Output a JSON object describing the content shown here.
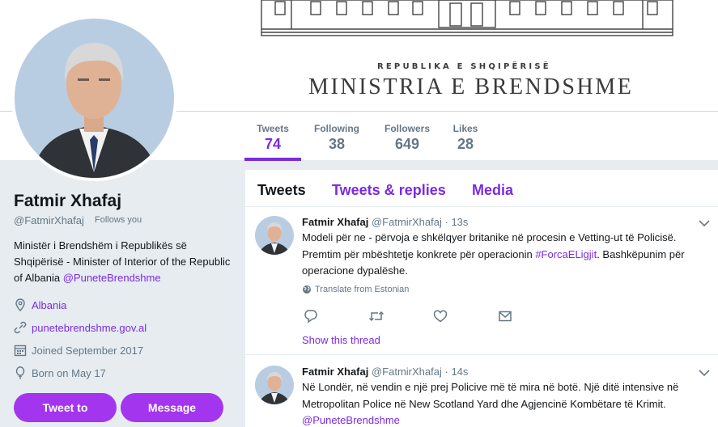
{
  "banner": {
    "republika": "REPUBLIKA E SHQIPËRISË",
    "ministria": "MINISTRIA E BRENDSHME"
  },
  "nav": {
    "items": [
      {
        "label": "Tweets",
        "value": "74"
      },
      {
        "label": "Following",
        "value": "38"
      },
      {
        "label": "Followers",
        "value": "649"
      },
      {
        "label": "Likes",
        "value": "28"
      }
    ]
  },
  "profile": {
    "name": "Fatmir Xhafaj",
    "handle": "@FatmirXhafaj",
    "follows_you": "Follows you",
    "bio_text": "Ministër i Brendshëm i Republikës së Shqipërisë - Minister of Interior of the Republic of Albania ",
    "bio_mention": "@PuneteBrendshme",
    "location": "Albania",
    "website": "punetebrendshme.gov.al",
    "joined": "Joined September 2017",
    "born": "Born on May 17",
    "tweet_to_label": "Tweet to",
    "message_label": "Message"
  },
  "tabs": {
    "tweets": "Tweets",
    "replies": "Tweets & replies",
    "media": "Media"
  },
  "tweets": [
    {
      "name": "Fatmir Xhafaj",
      "handle": "@FatmirXhafaj",
      "time": "· 13s",
      "text_line1": "Modeli për ne - përvoja e shkëlqyer britanike në procesin e Vetting-ut të Policisë.",
      "text_line2": "Premtim për mbështetje konkrete për operacionin ",
      "hashtag": "#ForcaELigjit",
      "text_line2_end": ". Bashkëpunim për",
      "text_line3": "operacione dypalëshe.",
      "translate": "Translate from Estonian",
      "show_thread": "Show this thread"
    },
    {
      "name": "Fatmir Xhafaj",
      "handle": "@FatmirXhafaj",
      "time": "· 14s",
      "text_line1": "Në Londër, në vendin e një prej Policive më të mira në botë. Një ditë intensive në",
      "text_line2": "Metropolitan Police në New Scotland Yard dhe Agjencinë Kombëtare të Krimit.",
      "mention": "@PuneteBrendshme"
    }
  ],
  "colors": {
    "accent": "#7a2be0",
    "button": "#a335ee",
    "background": "#e6ecf0"
  }
}
